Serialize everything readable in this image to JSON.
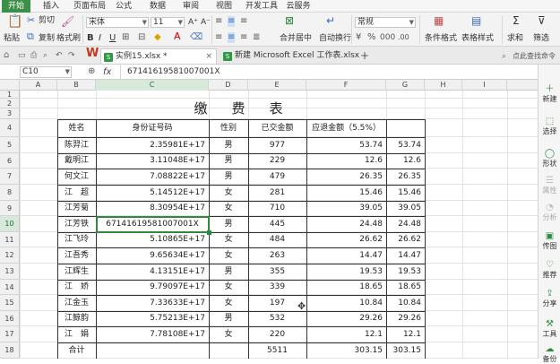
{
  "menu": {
    "tabs": [
      "开始",
      "插入",
      "页面布局",
      "公式",
      "数据",
      "审阅",
      "视图",
      "开发工具",
      "云服务"
    ],
    "active": "开始"
  },
  "ribbon": {
    "cut": "剪切",
    "paste": "粘贴",
    "copy": "复制",
    "format_painter": "格式刷",
    "font_name": "宋体",
    "font_size": "11",
    "bold": "B",
    "italic": "I",
    "underline": "U",
    "merge_center": "合并居中",
    "wrap_text": "自动换行",
    "number_format": "常规",
    "conditional_format": "条件格式",
    "table_style": "表格样式",
    "sum": "求和",
    "filter": "筛选"
  },
  "doc_tabs": {
    "active": "实例15.xlsx *",
    "other": "新建 Microsoft Excel 工作表.xlsx",
    "add": "+",
    "help": "点此查找命令"
  },
  "formula_bar": {
    "name_box": "C10",
    "fx": "fx",
    "content": "671416195810070​01X"
  },
  "columns": [
    "A",
    "B",
    "C",
    "D",
    "E",
    "F",
    "G",
    "H",
    "I"
  ],
  "rows": [
    "1",
    "2",
    "3",
    "4",
    "5",
    "6",
    "7",
    "8",
    "9",
    "10",
    "11",
    "12",
    "13",
    "14",
    "15",
    "16",
    "17",
    "18"
  ],
  "sheet": {
    "title": "缴　费　表",
    "headers": [
      "姓名",
      "身份证号码",
      "性别",
      "已交金额",
      "应退金额（5.5%）",
      ""
    ],
    "records": [
      [
        "陈羿江",
        "2.35981E+17",
        "男",
        "977",
        "53.74",
        "53.74"
      ],
      [
        "戴明江",
        "3.11048E+17",
        "男",
        "229",
        "12.6",
        "12.6"
      ],
      [
        "何文江",
        "7.08822E+17",
        "男",
        "479",
        "26.35",
        "26.35"
      ],
      [
        "江　超",
        "5.14512E+17",
        "女",
        "281",
        "15.46",
        "15.46"
      ],
      [
        "江芳菊",
        "8.30954E+17",
        "女",
        "710",
        "39.05",
        "39.05"
      ],
      [
        "江芳铁",
        "67141619581007001X",
        "男",
        "445",
        "24.48",
        "24.48"
      ],
      [
        "江飞玲",
        "5.10865E+17",
        "女",
        "484",
        "26.62",
        "26.62"
      ],
      [
        "江吾秀",
        "9.65634E+17",
        "女",
        "263",
        "14.47",
        "14.47"
      ],
      [
        "江辉生",
        "4.13151E+17",
        "男",
        "355",
        "19.53",
        "19.53"
      ],
      [
        "江　娇",
        "9.79097E+17",
        "女",
        "339",
        "18.65",
        "18.65"
      ],
      [
        "江金玉",
        "7.33633E+17",
        "女",
        "197",
        "10.84",
        "10.84"
      ],
      [
        "江鲸韵",
        "5.75213E+17",
        "男",
        "532",
        "29.26",
        "29.26"
      ],
      [
        "江　娟",
        "7.78108E+17",
        "女",
        "220",
        "12.1",
        "12.1"
      ]
    ],
    "total": [
      "合计",
      "",
      "",
      "5511",
      "303.15",
      "303.15"
    ]
  },
  "right_panel": [
    {
      "label": "新建",
      "icon": "new-icon",
      "enabled": true
    },
    {
      "label": "选择",
      "icon": "select-icon",
      "enabled": true
    },
    {
      "label": "形状",
      "icon": "shape-icon",
      "enabled": true
    },
    {
      "label": "属性",
      "icon": "property-icon",
      "enabled": false
    },
    {
      "label": "分析",
      "icon": "analysis-icon",
      "enabled": false
    },
    {
      "label": "传图",
      "icon": "upload-image-icon",
      "enabled": true
    },
    {
      "label": "推荐",
      "icon": "recommend-icon",
      "enabled": true
    },
    {
      "label": "分享",
      "icon": "share-icon",
      "enabled": true
    },
    {
      "label": "工具",
      "icon": "tools-icon",
      "enabled": true
    },
    {
      "label": "备份",
      "icon": "backup-icon",
      "enabled": true
    }
  ],
  "colors": {
    "accent": "#3d8f48",
    "selected_header": "#d7e9da"
  }
}
